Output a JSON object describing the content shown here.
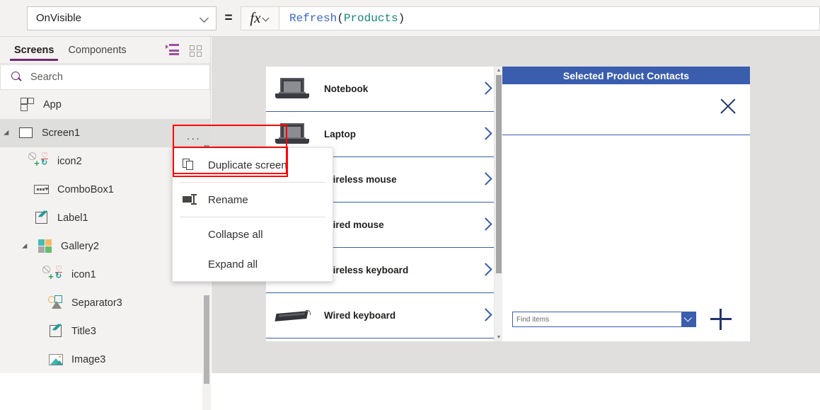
{
  "formula_bar": {
    "property": "OnVisible",
    "equals": "=",
    "fx_label": "fx",
    "formula_tokens": {
      "fn": "Refresh",
      "open": "( ",
      "table": "Products",
      "close": " )"
    }
  },
  "sidebar": {
    "tabs": [
      {
        "label": "Screens",
        "active": true
      },
      {
        "label": "Components",
        "active": false
      }
    ],
    "view_toggles": [
      {
        "icon": "tree-view-icon",
        "active": true
      },
      {
        "icon": "thumbnail-view-icon",
        "active": false
      }
    ],
    "search": {
      "placeholder": "Search",
      "value": "",
      "icon": "search-icon"
    },
    "tree": [
      {
        "label": "App",
        "icon": "app-icon",
        "depth": 0,
        "twisty": false,
        "selected": false
      },
      {
        "label": "Screen1",
        "icon": "screen-icon",
        "depth": 0,
        "twisty": true,
        "selected": true
      },
      {
        "label": "icon2",
        "icon": "icon-control-icon",
        "depth": 1,
        "twisty": false,
        "selected": false
      },
      {
        "label": "ComboBox1",
        "icon": "combobox-icon",
        "depth": 1,
        "twisty": false,
        "selected": false
      },
      {
        "label": "Label1",
        "icon": "label-icon",
        "depth": 1,
        "twisty": false,
        "selected": false
      },
      {
        "label": "Gallery2",
        "icon": "gallery-icon",
        "depth": 1,
        "twisty": true,
        "selected": false
      },
      {
        "label": "icon1",
        "icon": "icon-control-icon",
        "depth": 2,
        "twisty": false,
        "selected": false
      },
      {
        "label": "Separator3",
        "icon": "shapes-icon",
        "depth": 2,
        "twisty": false,
        "selected": false
      },
      {
        "label": "Title3",
        "icon": "label-icon",
        "depth": 2,
        "twisty": false,
        "selected": false
      },
      {
        "label": "Image3",
        "icon": "image-icon",
        "depth": 2,
        "twisty": false,
        "selected": false
      }
    ],
    "ellipsis_label": "..."
  },
  "context_menu": {
    "items": [
      {
        "label": "Duplicate screen",
        "icon": "duplicate-icon",
        "highlighted": true
      },
      {
        "label": "Rename",
        "icon": "rename-icon",
        "highlighted": false
      },
      {
        "label": "Collapse all",
        "icon": null,
        "highlighted": false
      },
      {
        "label": "Expand all",
        "icon": null,
        "highlighted": false
      }
    ]
  },
  "canvas": {
    "gallery": {
      "items": [
        {
          "label": "Notebook",
          "image": "laptop-photo"
        },
        {
          "label": "Laptop",
          "image": "laptop-photo"
        },
        {
          "label": "Wireless mouse",
          "image": "mouse-photo"
        },
        {
          "label": "Wired mouse",
          "image": "mouse-photo"
        },
        {
          "label": "Wireless keyboard",
          "image": "wireless-keyboard-photo"
        },
        {
          "label": "Wired keyboard",
          "image": "wired-keyboard-photo"
        }
      ],
      "chevron_icon": "chevron-right-icon"
    },
    "detail_panel": {
      "title": "Selected Product Contacts",
      "close_icon": "close-x-icon",
      "find_combo": {
        "placeholder": "Find items",
        "value": "",
        "dropdown_icon": "chevron-down-icon"
      },
      "add_icon": "plus-icon"
    }
  },
  "colors": {
    "accent_purple": "#742774",
    "panel_blue": "#3a5dae",
    "highlight_red": "#ff0000",
    "canvas_gray": "#e0dfde",
    "sidebar_gray": "#f3f2f1"
  }
}
